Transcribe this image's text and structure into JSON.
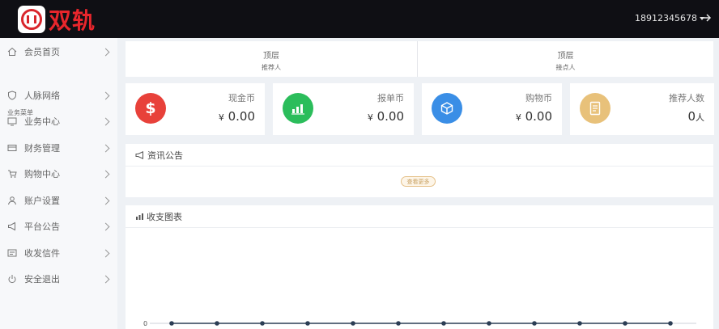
{
  "header": {
    "logo_text": "双轨",
    "username": "18912345678",
    "logout_icon": "logout-arrow-icon",
    "colors": {
      "bar": "#0f0f14",
      "brand": "#e8262c"
    }
  },
  "sidebar": {
    "section_title": "业务菜单",
    "items": [
      {
        "label": "会员首页",
        "icon": "home-icon"
      },
      {
        "label": "人脉网络",
        "icon": "shield-icon"
      },
      {
        "label": "业务中心",
        "icon": "monitor-icon"
      },
      {
        "label": "财务管理",
        "icon": "card-icon"
      },
      {
        "label": "购物中心",
        "icon": "cart-icon"
      },
      {
        "label": "账户设置",
        "icon": "user-icon"
      },
      {
        "label": "平台公告",
        "icon": "megaphone-icon"
      },
      {
        "label": "收发信件",
        "icon": "mail-icon"
      },
      {
        "label": "安全退出",
        "icon": "power-icon"
      }
    ]
  },
  "summary": {
    "left": {
      "title": "顶层",
      "subtitle": "推荐人"
    },
    "right": {
      "title": "顶层",
      "subtitle": "接点人"
    }
  },
  "stats": [
    {
      "title": "现金币",
      "prefix": "¥",
      "value": "0.00",
      "unit": "",
      "icon": "dollar-icon",
      "color": "#e8413a"
    },
    {
      "title": "报单币",
      "prefix": "¥",
      "value": "0.00",
      "unit": "",
      "icon": "bar-chart-icon",
      "color": "#2bbd5b"
    },
    {
      "title": "购物币",
      "prefix": "¥",
      "value": "0.00",
      "unit": "",
      "icon": "cube-icon",
      "color": "#3a8ee6"
    },
    {
      "title": "推荐人数",
      "prefix": "",
      "value": "0",
      "unit": "人",
      "icon": "document-icon",
      "color": "#e8c17a"
    }
  ],
  "notice": {
    "title": "资讯公告",
    "more_label": "查看更多"
  },
  "chart_panel": {
    "title": "收支图表"
  },
  "chart_data": {
    "type": "line",
    "series": [
      {
        "values": [
          0,
          0,
          0,
          0,
          0,
          0,
          0,
          0,
          0,
          0,
          0,
          0
        ]
      }
    ],
    "ytick_labels": [
      "0"
    ],
    "color": "#2c3e55"
  }
}
